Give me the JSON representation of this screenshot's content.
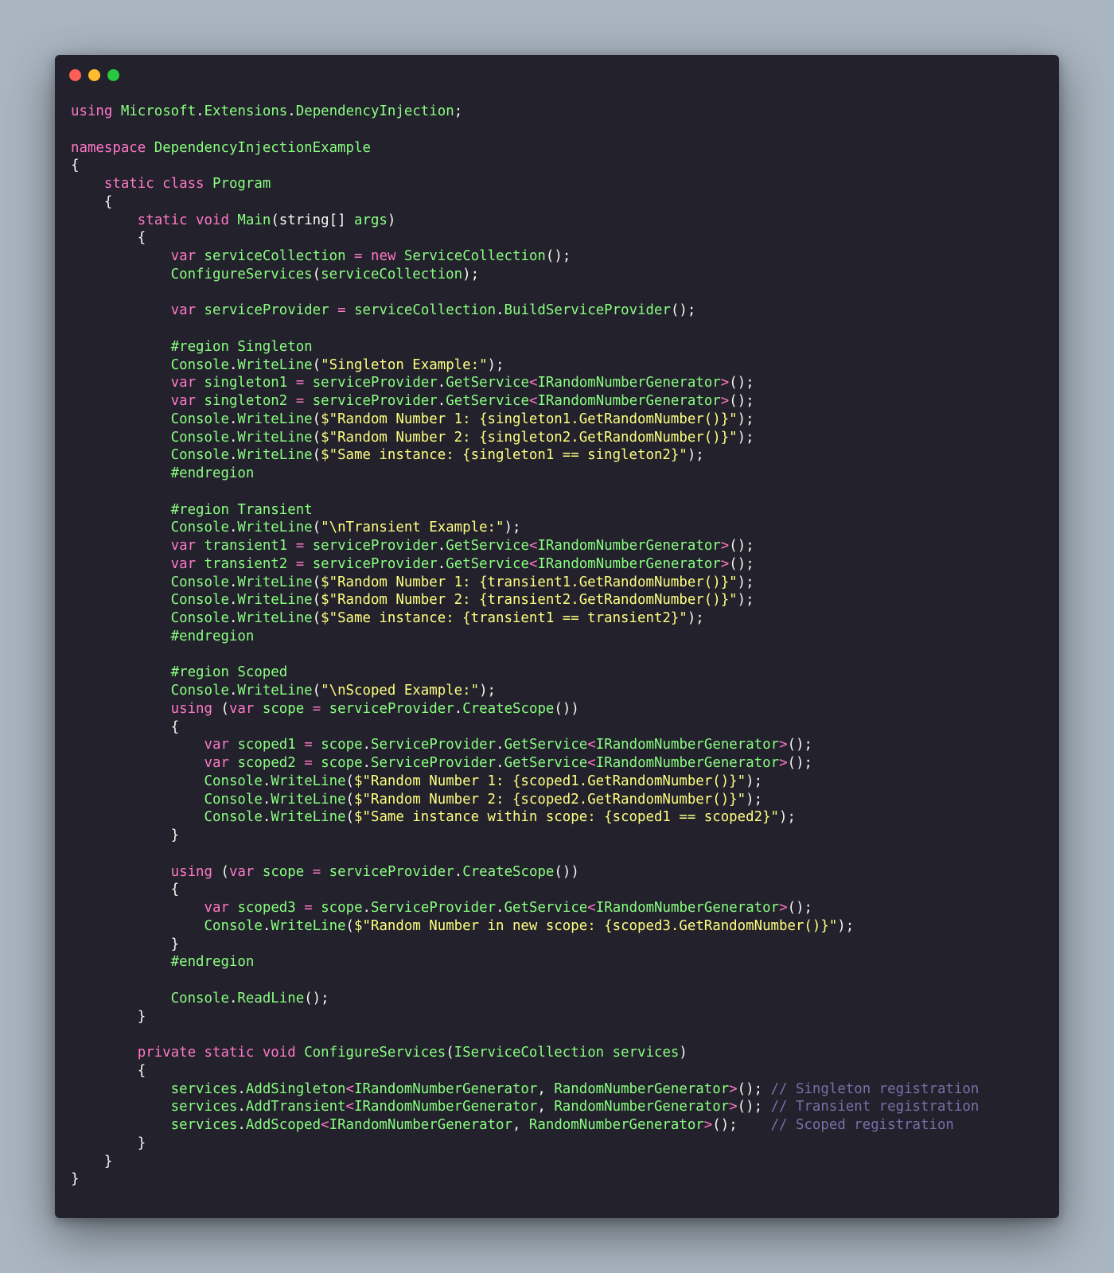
{
  "window": {
    "buttons": [
      "close",
      "minimize",
      "maximize"
    ],
    "colors": {
      "background": "#22212c",
      "close": "#ff5f57",
      "minimize": "#febc2e",
      "maximize": "#28c840"
    }
  },
  "syntax_colors": {
    "keyword": "#ff79c6",
    "identifier": "#8aff80",
    "punctuation": "#f8f8f2",
    "string": "#ffff80",
    "comment": "#7970a9"
  },
  "code_lines": [
    [
      [
        "k",
        "using"
      ],
      [
        "w",
        " "
      ],
      [
        "g",
        "Microsoft"
      ],
      [
        "w",
        "."
      ],
      [
        "g",
        "Extensions"
      ],
      [
        "w",
        "."
      ],
      [
        "g",
        "DependencyInjection"
      ],
      [
        "w",
        ";"
      ]
    ],
    [],
    [
      [
        "k",
        "namespace"
      ],
      [
        "w",
        " "
      ],
      [
        "g",
        "DependencyInjectionExample"
      ]
    ],
    [
      [
        "w",
        "{"
      ]
    ],
    [
      [
        "w",
        "    "
      ],
      [
        "k",
        "static class"
      ],
      [
        "w",
        " "
      ],
      [
        "g",
        "Program"
      ]
    ],
    [
      [
        "w",
        "    {"
      ]
    ],
    [
      [
        "w",
        "        "
      ],
      [
        "k",
        "static void"
      ],
      [
        "w",
        " "
      ],
      [
        "g",
        "Main"
      ],
      [
        "w",
        "(string[] "
      ],
      [
        "g",
        "args"
      ],
      [
        "w",
        ")"
      ]
    ],
    [
      [
        "w",
        "        {"
      ]
    ],
    [
      [
        "w",
        "            "
      ],
      [
        "k",
        "var"
      ],
      [
        "w",
        " "
      ],
      [
        "g",
        "serviceCollection"
      ],
      [
        "w",
        " "
      ],
      [
        "k",
        "="
      ],
      [
        "w",
        " "
      ],
      [
        "k",
        "new"
      ],
      [
        "w",
        " "
      ],
      [
        "g",
        "ServiceCollection"
      ],
      [
        "w",
        "();"
      ]
    ],
    [
      [
        "w",
        "            "
      ],
      [
        "g",
        "ConfigureServices"
      ],
      [
        "w",
        "("
      ],
      [
        "g",
        "serviceCollection"
      ],
      [
        "w",
        ");"
      ]
    ],
    [],
    [
      [
        "w",
        "            "
      ],
      [
        "k",
        "var"
      ],
      [
        "w",
        " "
      ],
      [
        "g",
        "serviceProvider"
      ],
      [
        "w",
        " "
      ],
      [
        "k",
        "="
      ],
      [
        "w",
        " "
      ],
      [
        "g",
        "serviceCollection"
      ],
      [
        "w",
        "."
      ],
      [
        "g",
        "BuildServiceProvider"
      ],
      [
        "w",
        "();"
      ]
    ],
    [],
    [
      [
        "w",
        "            "
      ],
      [
        "g",
        "#region Singleton"
      ]
    ],
    [
      [
        "w",
        "            "
      ],
      [
        "g",
        "Console"
      ],
      [
        "w",
        "."
      ],
      [
        "g",
        "WriteLine"
      ],
      [
        "w",
        "("
      ],
      [
        "s",
        "\"Singleton Example:\""
      ],
      [
        "w",
        ");"
      ]
    ],
    [
      [
        "w",
        "            "
      ],
      [
        "k",
        "var"
      ],
      [
        "w",
        " "
      ],
      [
        "g",
        "singleton1"
      ],
      [
        "w",
        " "
      ],
      [
        "k",
        "="
      ],
      [
        "w",
        " "
      ],
      [
        "g",
        "serviceProvider"
      ],
      [
        "w",
        "."
      ],
      [
        "g",
        "GetService"
      ],
      [
        "k",
        "<"
      ],
      [
        "g",
        "IRandomNumberGenerator"
      ],
      [
        "k",
        ">"
      ],
      [
        "w",
        "();"
      ]
    ],
    [
      [
        "w",
        "            "
      ],
      [
        "k",
        "var"
      ],
      [
        "w",
        " "
      ],
      [
        "g",
        "singleton2"
      ],
      [
        "w",
        " "
      ],
      [
        "k",
        "="
      ],
      [
        "w",
        " "
      ],
      [
        "g",
        "serviceProvider"
      ],
      [
        "w",
        "."
      ],
      [
        "g",
        "GetService"
      ],
      [
        "k",
        "<"
      ],
      [
        "g",
        "IRandomNumberGenerator"
      ],
      [
        "k",
        ">"
      ],
      [
        "w",
        "();"
      ]
    ],
    [
      [
        "w",
        "            "
      ],
      [
        "g",
        "Console"
      ],
      [
        "w",
        "."
      ],
      [
        "g",
        "WriteLine"
      ],
      [
        "w",
        "("
      ],
      [
        "s",
        "$\"Random Number 1: {singleton1.GetRandomNumber()}\""
      ],
      [
        "w",
        ");"
      ]
    ],
    [
      [
        "w",
        "            "
      ],
      [
        "g",
        "Console"
      ],
      [
        "w",
        "."
      ],
      [
        "g",
        "WriteLine"
      ],
      [
        "w",
        "("
      ],
      [
        "s",
        "$\"Random Number 2: {singleton2.GetRandomNumber()}\""
      ],
      [
        "w",
        ");"
      ]
    ],
    [
      [
        "w",
        "            "
      ],
      [
        "g",
        "Console"
      ],
      [
        "w",
        "."
      ],
      [
        "g",
        "WriteLine"
      ],
      [
        "w",
        "("
      ],
      [
        "s",
        "$\"Same instance: {singleton1 == singleton2}\""
      ],
      [
        "w",
        ");"
      ]
    ],
    [
      [
        "w",
        "            "
      ],
      [
        "g",
        "#endregion"
      ]
    ],
    [],
    [
      [
        "w",
        "            "
      ],
      [
        "g",
        "#region Transient"
      ]
    ],
    [
      [
        "w",
        "            "
      ],
      [
        "g",
        "Console"
      ],
      [
        "w",
        "."
      ],
      [
        "g",
        "WriteLine"
      ],
      [
        "w",
        "("
      ],
      [
        "s",
        "\"\\nTransient Example:\""
      ],
      [
        "w",
        ");"
      ]
    ],
    [
      [
        "w",
        "            "
      ],
      [
        "k",
        "var"
      ],
      [
        "w",
        " "
      ],
      [
        "g",
        "transient1"
      ],
      [
        "w",
        " "
      ],
      [
        "k",
        "="
      ],
      [
        "w",
        " "
      ],
      [
        "g",
        "serviceProvider"
      ],
      [
        "w",
        "."
      ],
      [
        "g",
        "GetService"
      ],
      [
        "k",
        "<"
      ],
      [
        "g",
        "IRandomNumberGenerator"
      ],
      [
        "k",
        ">"
      ],
      [
        "w",
        "();"
      ]
    ],
    [
      [
        "w",
        "            "
      ],
      [
        "k",
        "var"
      ],
      [
        "w",
        " "
      ],
      [
        "g",
        "transient2"
      ],
      [
        "w",
        " "
      ],
      [
        "k",
        "="
      ],
      [
        "w",
        " "
      ],
      [
        "g",
        "serviceProvider"
      ],
      [
        "w",
        "."
      ],
      [
        "g",
        "GetService"
      ],
      [
        "k",
        "<"
      ],
      [
        "g",
        "IRandomNumberGenerator"
      ],
      [
        "k",
        ">"
      ],
      [
        "w",
        "();"
      ]
    ],
    [
      [
        "w",
        "            "
      ],
      [
        "g",
        "Console"
      ],
      [
        "w",
        "."
      ],
      [
        "g",
        "WriteLine"
      ],
      [
        "w",
        "("
      ],
      [
        "s",
        "$\"Random Number 1: {transient1.GetRandomNumber()}\""
      ],
      [
        "w",
        ");"
      ]
    ],
    [
      [
        "w",
        "            "
      ],
      [
        "g",
        "Console"
      ],
      [
        "w",
        "."
      ],
      [
        "g",
        "WriteLine"
      ],
      [
        "w",
        "("
      ],
      [
        "s",
        "$\"Random Number 2: {transient2.GetRandomNumber()}\""
      ],
      [
        "w",
        ");"
      ]
    ],
    [
      [
        "w",
        "            "
      ],
      [
        "g",
        "Console"
      ],
      [
        "w",
        "."
      ],
      [
        "g",
        "WriteLine"
      ],
      [
        "w",
        "("
      ],
      [
        "s",
        "$\"Same instance: {transient1 == transient2}\""
      ],
      [
        "w",
        ");"
      ]
    ],
    [
      [
        "w",
        "            "
      ],
      [
        "g",
        "#endregion"
      ]
    ],
    [],
    [
      [
        "w",
        "            "
      ],
      [
        "g",
        "#region Scoped"
      ]
    ],
    [
      [
        "w",
        "            "
      ],
      [
        "g",
        "Console"
      ],
      [
        "w",
        "."
      ],
      [
        "g",
        "WriteLine"
      ],
      [
        "w",
        "("
      ],
      [
        "s",
        "\"\\nScoped Example:\""
      ],
      [
        "w",
        ");"
      ]
    ],
    [
      [
        "w",
        "            "
      ],
      [
        "k",
        "using"
      ],
      [
        "w",
        " ("
      ],
      [
        "k",
        "var"
      ],
      [
        "w",
        " "
      ],
      [
        "g",
        "scope"
      ],
      [
        "w",
        " "
      ],
      [
        "k",
        "="
      ],
      [
        "w",
        " "
      ],
      [
        "g",
        "serviceProvider"
      ],
      [
        "w",
        "."
      ],
      [
        "g",
        "CreateScope"
      ],
      [
        "w",
        "())"
      ]
    ],
    [
      [
        "w",
        "            {"
      ]
    ],
    [
      [
        "w",
        "                "
      ],
      [
        "k",
        "var"
      ],
      [
        "w",
        " "
      ],
      [
        "g",
        "scoped1"
      ],
      [
        "w",
        " "
      ],
      [
        "k",
        "="
      ],
      [
        "w",
        " "
      ],
      [
        "g",
        "scope"
      ],
      [
        "w",
        "."
      ],
      [
        "g",
        "ServiceProvider"
      ],
      [
        "w",
        "."
      ],
      [
        "g",
        "GetService"
      ],
      [
        "k",
        "<"
      ],
      [
        "g",
        "IRandomNumberGenerator"
      ],
      [
        "k",
        ">"
      ],
      [
        "w",
        "();"
      ]
    ],
    [
      [
        "w",
        "                "
      ],
      [
        "k",
        "var"
      ],
      [
        "w",
        " "
      ],
      [
        "g",
        "scoped2"
      ],
      [
        "w",
        " "
      ],
      [
        "k",
        "="
      ],
      [
        "w",
        " "
      ],
      [
        "g",
        "scope"
      ],
      [
        "w",
        "."
      ],
      [
        "g",
        "ServiceProvider"
      ],
      [
        "w",
        "."
      ],
      [
        "g",
        "GetService"
      ],
      [
        "k",
        "<"
      ],
      [
        "g",
        "IRandomNumberGenerator"
      ],
      [
        "k",
        ">"
      ],
      [
        "w",
        "();"
      ]
    ],
    [
      [
        "w",
        "                "
      ],
      [
        "g",
        "Console"
      ],
      [
        "w",
        "."
      ],
      [
        "g",
        "WriteLine"
      ],
      [
        "w",
        "("
      ],
      [
        "s",
        "$\"Random Number 1: {scoped1.GetRandomNumber()}\""
      ],
      [
        "w",
        ");"
      ]
    ],
    [
      [
        "w",
        "                "
      ],
      [
        "g",
        "Console"
      ],
      [
        "w",
        "."
      ],
      [
        "g",
        "WriteLine"
      ],
      [
        "w",
        "("
      ],
      [
        "s",
        "$\"Random Number 2: {scoped2.GetRandomNumber()}\""
      ],
      [
        "w",
        ");"
      ]
    ],
    [
      [
        "w",
        "                "
      ],
      [
        "g",
        "Console"
      ],
      [
        "w",
        "."
      ],
      [
        "g",
        "WriteLine"
      ],
      [
        "w",
        "("
      ],
      [
        "s",
        "$\"Same instance within scope: {scoped1 == scoped2}\""
      ],
      [
        "w",
        ");"
      ]
    ],
    [
      [
        "w",
        "            }"
      ]
    ],
    [],
    [
      [
        "w",
        "            "
      ],
      [
        "k",
        "using"
      ],
      [
        "w",
        " ("
      ],
      [
        "k",
        "var"
      ],
      [
        "w",
        " "
      ],
      [
        "g",
        "scope"
      ],
      [
        "w",
        " "
      ],
      [
        "k",
        "="
      ],
      [
        "w",
        " "
      ],
      [
        "g",
        "serviceProvider"
      ],
      [
        "w",
        "."
      ],
      [
        "g",
        "CreateScope"
      ],
      [
        "w",
        "())"
      ]
    ],
    [
      [
        "w",
        "            {"
      ]
    ],
    [
      [
        "w",
        "                "
      ],
      [
        "k",
        "var"
      ],
      [
        "w",
        " "
      ],
      [
        "g",
        "scoped3"
      ],
      [
        "w",
        " "
      ],
      [
        "k",
        "="
      ],
      [
        "w",
        " "
      ],
      [
        "g",
        "scope"
      ],
      [
        "w",
        "."
      ],
      [
        "g",
        "ServiceProvider"
      ],
      [
        "w",
        "."
      ],
      [
        "g",
        "GetService"
      ],
      [
        "k",
        "<"
      ],
      [
        "g",
        "IRandomNumberGenerator"
      ],
      [
        "k",
        ">"
      ],
      [
        "w",
        "();"
      ]
    ],
    [
      [
        "w",
        "                "
      ],
      [
        "g",
        "Console"
      ],
      [
        "w",
        "."
      ],
      [
        "g",
        "WriteLine"
      ],
      [
        "w",
        "("
      ],
      [
        "s",
        "$\"Random Number in new scope: {scoped3.GetRandomNumber()}\""
      ],
      [
        "w",
        ");"
      ]
    ],
    [
      [
        "w",
        "            }"
      ]
    ],
    [
      [
        "w",
        "            "
      ],
      [
        "g",
        "#endregion"
      ]
    ],
    [],
    [
      [
        "w",
        "            "
      ],
      [
        "g",
        "Console"
      ],
      [
        "w",
        "."
      ],
      [
        "g",
        "ReadLine"
      ],
      [
        "w",
        "();"
      ]
    ],
    [
      [
        "w",
        "        }"
      ]
    ],
    [],
    [
      [
        "w",
        "        "
      ],
      [
        "k",
        "private static void"
      ],
      [
        "w",
        " "
      ],
      [
        "g",
        "ConfigureServices"
      ],
      [
        "w",
        "("
      ],
      [
        "g",
        "IServiceCollection"
      ],
      [
        "w",
        " "
      ],
      [
        "g",
        "services"
      ],
      [
        "w",
        ")"
      ]
    ],
    [
      [
        "w",
        "        {"
      ]
    ],
    [
      [
        "w",
        "            "
      ],
      [
        "g",
        "services"
      ],
      [
        "w",
        "."
      ],
      [
        "g",
        "AddSingleton"
      ],
      [
        "k",
        "<"
      ],
      [
        "g",
        "IRandomNumberGenerator"
      ],
      [
        "w",
        ", "
      ],
      [
        "g",
        "RandomNumberGenerator"
      ],
      [
        "k",
        ">"
      ],
      [
        "w",
        "(); "
      ],
      [
        "c",
        "// Singleton registration"
      ]
    ],
    [
      [
        "w",
        "            "
      ],
      [
        "g",
        "services"
      ],
      [
        "w",
        "."
      ],
      [
        "g",
        "AddTransient"
      ],
      [
        "k",
        "<"
      ],
      [
        "g",
        "IRandomNumberGenerator"
      ],
      [
        "w",
        ", "
      ],
      [
        "g",
        "RandomNumberGenerator"
      ],
      [
        "k",
        ">"
      ],
      [
        "w",
        "(); "
      ],
      [
        "c",
        "// Transient registration"
      ]
    ],
    [
      [
        "w",
        "            "
      ],
      [
        "g",
        "services"
      ],
      [
        "w",
        "."
      ],
      [
        "g",
        "AddScoped"
      ],
      [
        "k",
        "<"
      ],
      [
        "g",
        "IRandomNumberGenerator"
      ],
      [
        "w",
        ", "
      ],
      [
        "g",
        "RandomNumberGenerator"
      ],
      [
        "k",
        ">"
      ],
      [
        "w",
        "();    "
      ],
      [
        "c",
        "// Scoped registration"
      ]
    ],
    [
      [
        "w",
        "        }"
      ]
    ],
    [
      [
        "w",
        "    }"
      ]
    ],
    [
      [
        "w",
        "}"
      ]
    ]
  ]
}
